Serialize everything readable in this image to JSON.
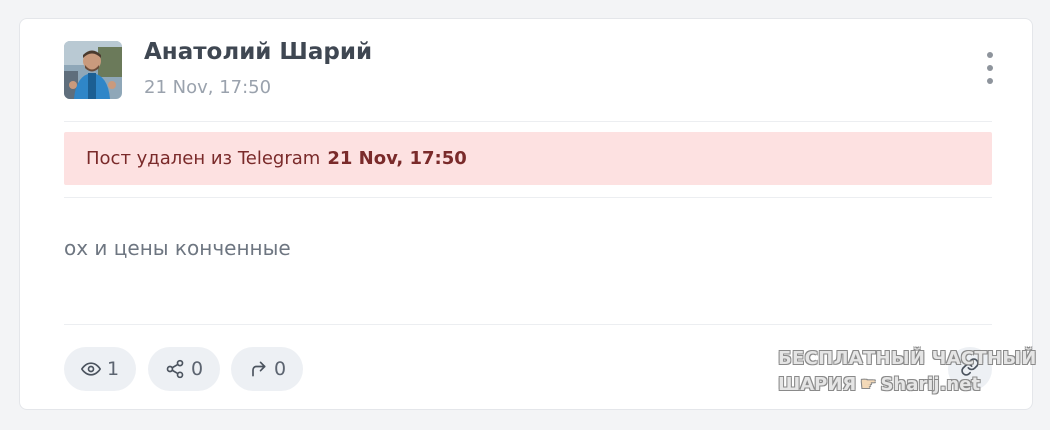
{
  "post": {
    "author_name": "Анатолий Шарий",
    "time": "21 Nov, 17:50",
    "deleted_notice": {
      "text": "Пост удален из Telegram",
      "time": "21 Nov, 17:50"
    },
    "text": "ох и цены конченные"
  },
  "stats": {
    "views": "1",
    "shares": "0",
    "forwards": "0"
  },
  "icons": {
    "menu": "more-vertical-icon",
    "views": "eye-icon",
    "shares": "share-icon",
    "forwards": "forward-arrow-icon",
    "link": "link-icon"
  },
  "watermark": {
    "line1": "БЕСПЛАТНЫЙ ЧАСТНЫЙ",
    "line2": "ШАРИЯ",
    "site": "Sharij.net"
  },
  "colors": {
    "deleted_banner_bg": "#fde1e1",
    "deleted_banner_text": "#7a2a2a",
    "stat_bg": "#edf0f4"
  }
}
